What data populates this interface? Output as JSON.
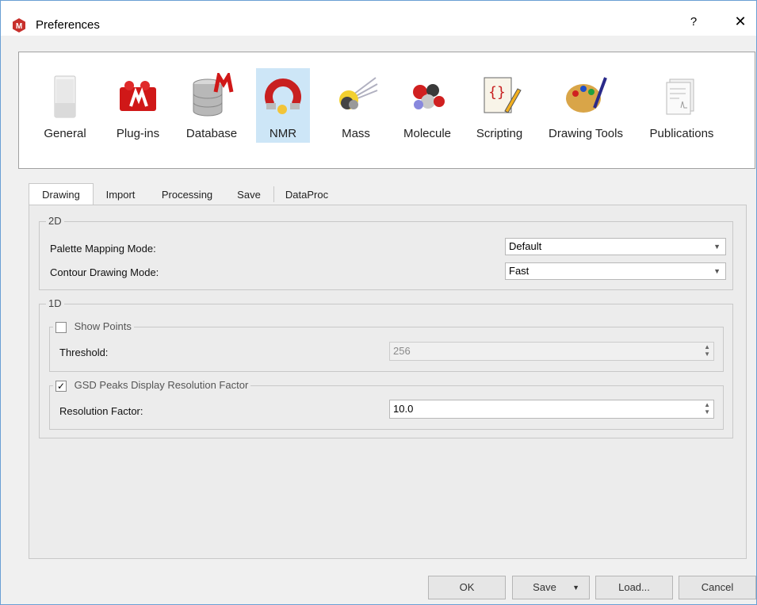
{
  "window": {
    "title": "Preferences",
    "help_label": "?",
    "close_label": "✕"
  },
  "categories": [
    {
      "label": "General",
      "icon": "general-icon"
    },
    {
      "label": "Plug-ins",
      "icon": "plugins-icon"
    },
    {
      "label": "Database",
      "icon": "database-icon"
    },
    {
      "label": "NMR",
      "icon": "nmr-magnet-icon",
      "selected": true
    },
    {
      "label": "Mass",
      "icon": "mass-icon"
    },
    {
      "label": "Molecule",
      "icon": "molecule-icon"
    },
    {
      "label": "Scripting",
      "icon": "scripting-icon"
    },
    {
      "label": "Drawing Tools",
      "icon": "palette-icon"
    },
    {
      "label": "Publications",
      "icon": "publications-icon"
    }
  ],
  "tabs": [
    {
      "label": "Drawing",
      "active": true
    },
    {
      "label": "Import"
    },
    {
      "label": "Processing"
    },
    {
      "label": "Save"
    },
    {
      "label": "DataProc"
    }
  ],
  "group_2d": {
    "title": "2D",
    "palette_label": "Palette Mapping Mode:",
    "palette_value": "Default",
    "contour_label": "Contour Drawing Mode:",
    "contour_value": "Fast"
  },
  "group_1d": {
    "title": "1D",
    "show_points": {
      "label": "Show Points",
      "checked": false,
      "threshold_label": "Threshold:",
      "threshold_value": "256"
    },
    "gsd": {
      "label": "GSD Peaks Display Resolution Factor",
      "checked": true,
      "check_mark": "✓",
      "resolution_label": "Resolution Factor:",
      "resolution_value": "10.0"
    }
  },
  "buttons": {
    "ok": "OK",
    "save": "Save",
    "load": "Load...",
    "cancel": "Cancel"
  },
  "colors": {
    "accent": "#6a9fd4",
    "selected_category": "#cde6f7",
    "app_icon": "#c8302c"
  }
}
